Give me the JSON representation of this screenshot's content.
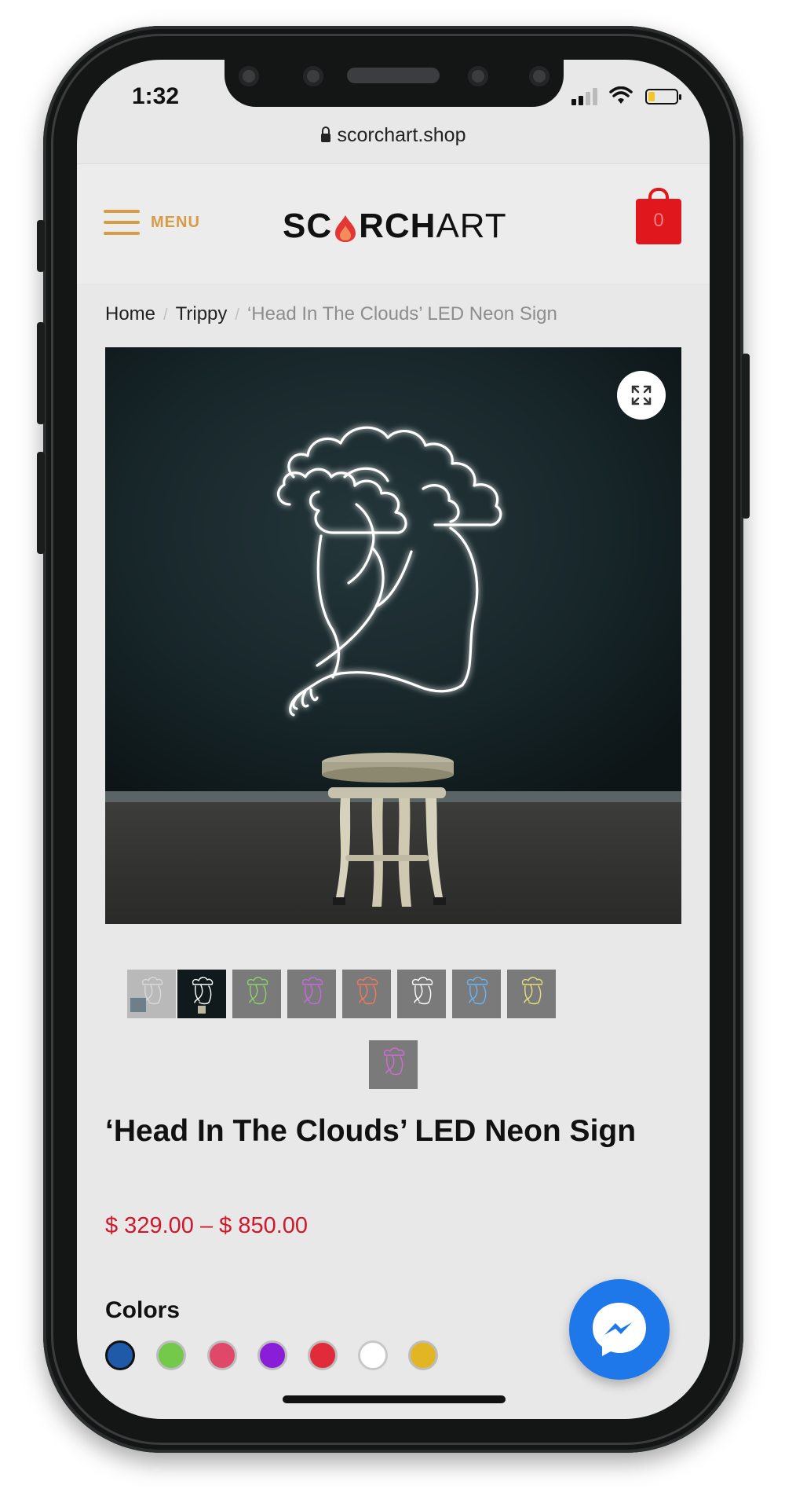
{
  "status_bar": {
    "time": "1:32"
  },
  "browser": {
    "url": "scorchart.shop"
  },
  "header": {
    "menu_label": "MENU",
    "logo": {
      "part1": "SC",
      "part2": "RCH",
      "part3": "ART"
    },
    "cart_count": "0",
    "brand_colors": {
      "accent": "#d79c45",
      "cart": "#e0171d"
    }
  },
  "breadcrumb": {
    "items": [
      "Home",
      "Trippy"
    ],
    "current": "‘Head In The Clouds’ LED Neon Sign"
  },
  "gallery": {
    "zoom_icon": "expand-icon",
    "thumbnail_tints": [
      "#d9d9d9",
      "#ffffff",
      "#8ad36a",
      "#c66ae0",
      "#f07a5a",
      "#ffffff",
      "#6ab4f0",
      "#e5e07a",
      "#d36ad9"
    ]
  },
  "product": {
    "title": "‘Head In The Clouds’ LED Neon Sign",
    "price": "$ 329.00 – $ 850.00"
  },
  "colors": {
    "label": "Colors",
    "swatches": [
      "#1e5aa8",
      "#74c94a",
      "#e0486a",
      "#8a1ed8",
      "#e12a3a",
      "#ffffff",
      "#e2b623"
    ],
    "selected_index": 0
  },
  "chat": {
    "icon": "messenger-icon"
  }
}
